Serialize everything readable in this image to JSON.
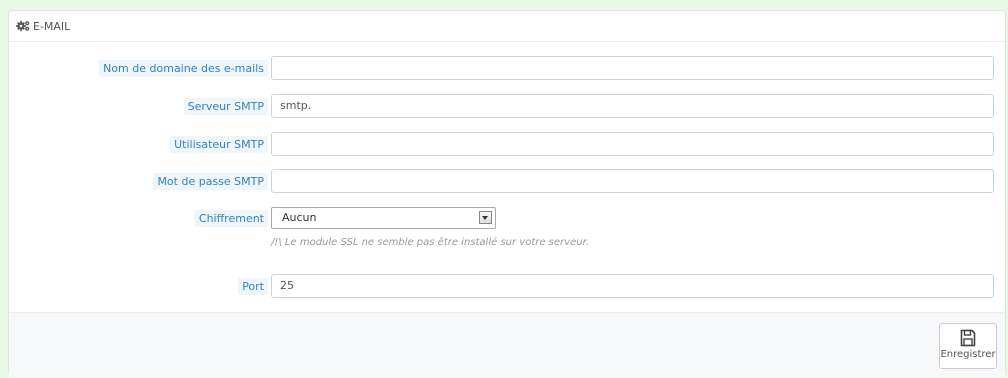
{
  "panel": {
    "title": "E-MAIL",
    "title_icon": "cogs-icon"
  },
  "fields": {
    "domain": {
      "label": "Nom de domaine des e-mails",
      "value": ""
    },
    "smtp_server": {
      "label": "Serveur SMTP",
      "value": "smtp."
    },
    "smtp_user": {
      "label": "Utilisateur SMTP",
      "value": ""
    },
    "smtp_password": {
      "label": "Mot de passe SMTP",
      "value": ""
    },
    "encryption": {
      "label": "Chiffrement",
      "selected": "Aucun",
      "help": "/!\\ Le module SSL ne semble pas être installé sur votre serveur."
    },
    "port": {
      "label": "Port",
      "value": "25"
    }
  },
  "footer": {
    "save_label": "Enregistrer",
    "save_icon": "floppy-disk-icon"
  },
  "colors": {
    "page_background": "#e8f7e6",
    "label_text": "#3582b5",
    "label_background": "#eef6fb"
  }
}
